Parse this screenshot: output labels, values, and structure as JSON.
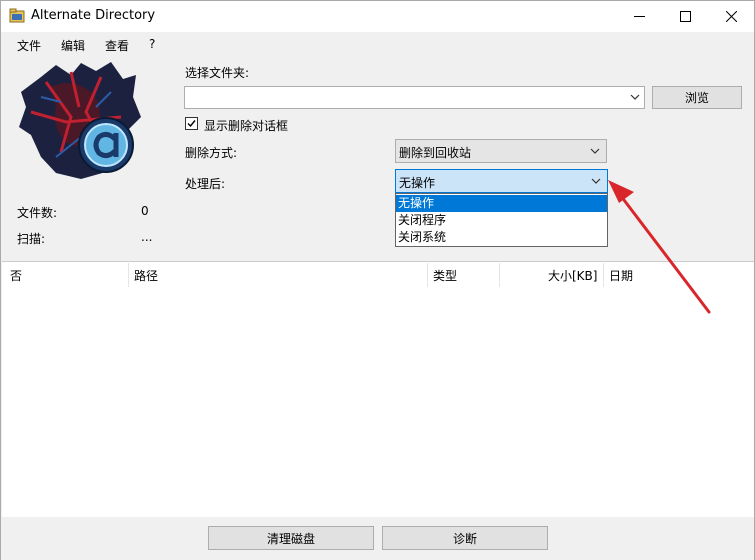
{
  "window": {
    "title": "Alternate Directory"
  },
  "menu": [
    "文件",
    "编辑",
    "查看",
    "?"
  ],
  "form": {
    "folder_label": "选择文件夹:",
    "folder_value": "",
    "browse_label": "浏览",
    "show_dialog_label": "显示删除对话框",
    "show_dialog_checked": true,
    "delete_method_label": "删除方式:",
    "delete_method_value": "删除到回收站",
    "after_label": "处理后:",
    "after_value": "无操作",
    "after_options": [
      "无操作",
      "关闭程序",
      "关闭系统"
    ]
  },
  "stats": {
    "files_label": "文件数:",
    "files_value": "0",
    "scan_label": "扫描:",
    "scan_value": "..."
  },
  "table": {
    "columns": [
      "否",
      "路径",
      "类型",
      "大小[KB]",
      "日期"
    ],
    "rows": []
  },
  "buttons": {
    "clean": "清理磁盘",
    "diagnose": "诊断"
  },
  "colors": {
    "selection": "#0078d7",
    "annotation_arrow": "#d9262b"
  }
}
